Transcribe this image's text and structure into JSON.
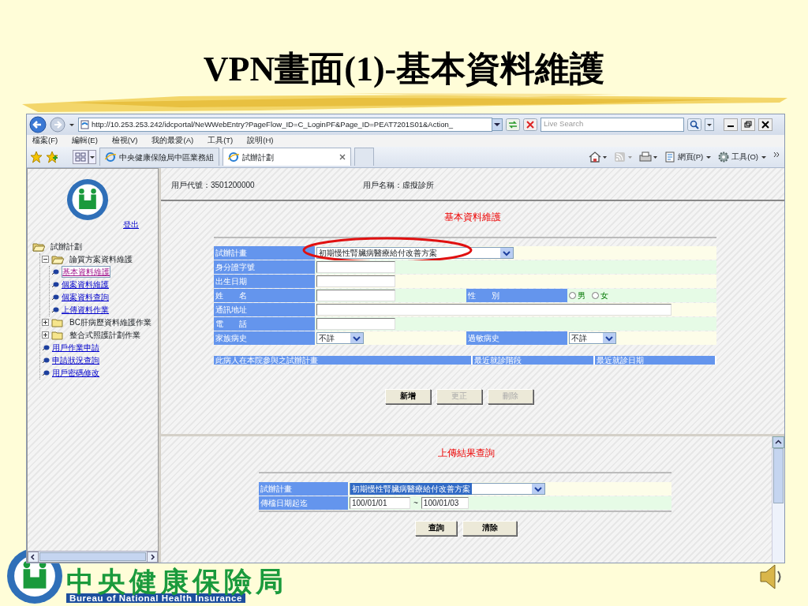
{
  "slide_title": "VPN畫面(1)-基本資料維護",
  "browser": {
    "address": "http://10.253.253.242/idcportal/NeWWebEntry?PageFlow_ID=C_LoginPF&Page_ID=PEAT7201S01&Action_",
    "search_placeholder": "Live Search",
    "menu": [
      "檔案(F)",
      "編輯(E)",
      "檢視(V)",
      "我的最愛(A)",
      "工具(T)",
      "說明(H)"
    ],
    "tabs": [
      {
        "label": "中央健康保險局中區業務組",
        "selected": false
      },
      {
        "label": "試辦計劃",
        "selected": true
      }
    ],
    "commands": [
      "網頁(P)",
      "工具(O)"
    ]
  },
  "sidebar": {
    "logout": "登出",
    "tree": [
      {
        "label": "試辦計劃",
        "kind": "folder",
        "expanded": true,
        "children": [
          {
            "label": "論質方案資料維護",
            "kind": "folder",
            "expanded": true,
            "children": [
              {
                "label": "基本資料維護",
                "kind": "link",
                "selected": true
              },
              {
                "label": "個案資料維護",
                "kind": "link",
                "selected": false
              },
              {
                "label": "個案資料查詢",
                "kind": "link",
                "selected": false
              },
              {
                "label": "上傳資料作業",
                "kind": "link",
                "selected": false
              }
            ]
          },
          {
            "label": "BC肝病歷資料維護作業",
            "kind": "folder",
            "expanded": false
          },
          {
            "label": "整合式照護計劃作業",
            "kind": "folder",
            "expanded": false
          },
          {
            "label": "用戶作業申請",
            "kind": "link",
            "selected": false
          },
          {
            "label": "申請狀況查詢",
            "kind": "link",
            "selected": false
          },
          {
            "label": "用戶密碼修改",
            "kind": "link",
            "selected": false
          }
        ]
      }
    ]
  },
  "user_id": "用戶代號：3501200000",
  "user_name": "用戶名稱：虛擬診所",
  "basic_form": {
    "title": "基本資料維護",
    "rows": [
      [
        {
          "label": "試辦計畫",
          "kind": "select",
          "value": "初期慢性腎臟病醫療給付改善方案",
          "highlighted": true
        }
      ],
      [
        {
          "label": "身分證字號",
          "kind": "text"
        }
      ],
      [
        {
          "label": "出生日期",
          "kind": "text"
        }
      ],
      [
        {
          "label": "姓　　名",
          "kind": "text"
        },
        {
          "label": "性　　別",
          "kind": "radio",
          "options": [
            {
              "label": "男",
              "selected": false
            },
            {
              "label": "女",
              "selected": false
            }
          ]
        }
      ],
      [
        {
          "label": "通訊地址",
          "kind": "long-text"
        }
      ],
      [
        {
          "label": "電　　話",
          "kind": "text"
        }
      ],
      [
        {
          "label": "家族病史",
          "kind": "small-select",
          "value": "不詳"
        },
        {
          "label": "過敏病史",
          "kind": "small-select",
          "value": "不詳"
        }
      ]
    ],
    "table_columns": [
      "此病人在本院參與之試辦計畫",
      "最近就診階段",
      "最近就診日期"
    ],
    "buttons": [
      {
        "label": "新增",
        "disabled": false
      },
      {
        "label": "更正",
        "disabled": true
      },
      {
        "label": "刪除",
        "disabled": true
      }
    ]
  },
  "upload_query": {
    "title": "上傳結果查詢",
    "rows": [
      [
        {
          "label": "試辦計畫",
          "kind": "select",
          "value": "初期慢性腎臟病醫療給付改善方案",
          "text_selected": true
        }
      ],
      [
        {
          "label": "傳檔日期起迄",
          "kind": "date-range",
          "from": "100/01/01",
          "separator": "~",
          "to": "100/01/03"
        }
      ]
    ],
    "buttons": [
      {
        "label": "查詢",
        "disabled": false
      },
      {
        "label": "清除",
        "disabled": false
      }
    ]
  },
  "footer": {
    "name": "中央健康保險局",
    "english_name": "Bureau of National Health Insurance"
  }
}
